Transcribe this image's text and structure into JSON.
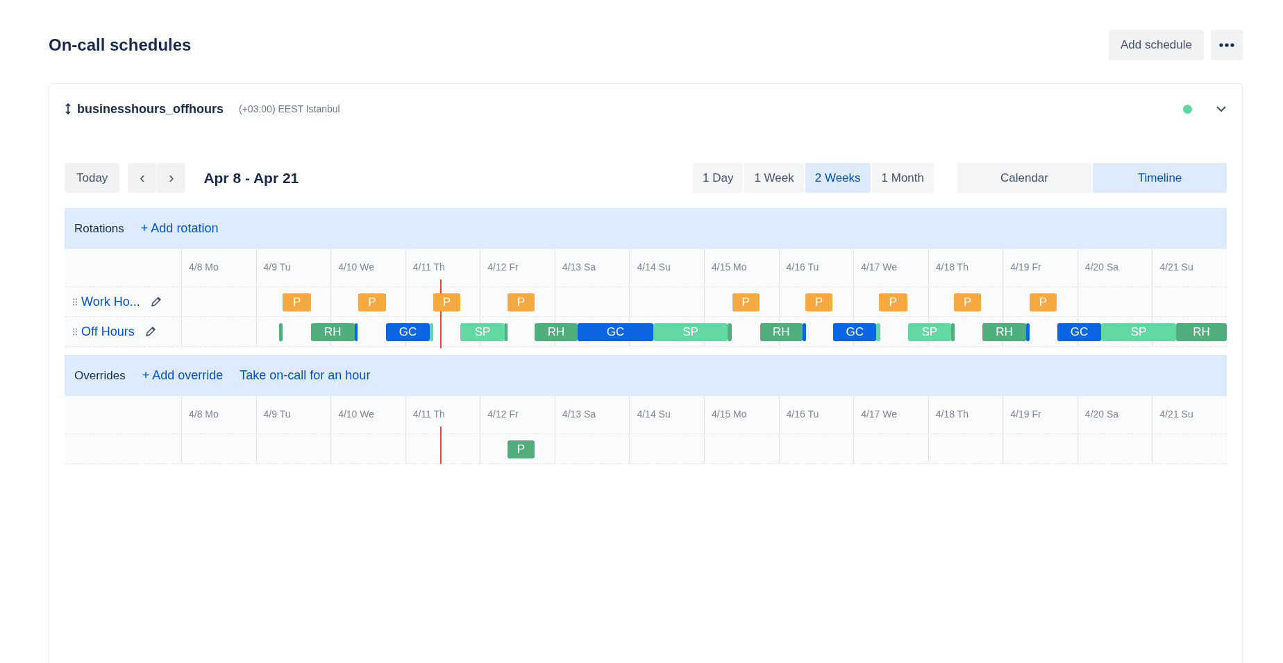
{
  "page": {
    "title": "On-call schedules",
    "buttons": [
      "Add schedule"
    ]
  },
  "schedule": {
    "name": "businesshours_offhours",
    "timezone": "(+03:00) EEST Istanbul",
    "expanded": true
  },
  "toolbar": {
    "today": "Today",
    "prev": "‹",
    "next": "›",
    "range_label": "Apr 8 - Apr 21",
    "ranges": [
      {
        "label": "1 Day",
        "selected": false
      },
      {
        "label": "1 Week",
        "selected": false
      },
      {
        "label": "2 Weeks",
        "selected": true
      },
      {
        "label": "1 Month",
        "selected": false
      }
    ],
    "views": [
      {
        "label": "Calendar",
        "selected": false
      },
      {
        "label": "Timeline",
        "selected": true
      }
    ]
  },
  "rotations": {
    "title": "Rotations",
    "actions": [
      "+ Add rotation"
    ],
    "days": [
      "4/8 Mo",
      "4/9 Tu",
      "4/10 We",
      "4/11 Th",
      "4/12 Fr",
      "4/13 Sa",
      "4/14 Su",
      "4/15 Mo",
      "4/16 Tu",
      "4/17 We",
      "4/18 Th",
      "4/19 Fr",
      "4/20 Sa",
      "4/21 Su"
    ],
    "rows": [
      {
        "name": "Work Ho...",
        "blocks": [
          {
            "label": "P",
            "color": "#f5a940"
          },
          {
            "label": "P",
            "color": "#f5a940"
          },
          {
            "label": "P",
            "color": "#f5a940"
          },
          {
            "label": "P",
            "color": "#f5a940"
          },
          {
            "label": "P",
            "color": "#f5a940"
          },
          {
            "label": "P",
            "color": "#f5a940"
          },
          {
            "label": "P",
            "color": "#f5a940"
          },
          {
            "label": "P",
            "color": "#f5a940"
          },
          {
            "label": "P",
            "color": "#f5a940"
          }
        ]
      },
      {
        "name": "Off Hours",
        "blocks": [
          {
            "color": "#4fae7c"
          },
          {
            "label": "RH",
            "color": "#4fae7c"
          },
          {
            "color": "#0c66e4"
          },
          {
            "label": "GC",
            "color": "#0c66e4"
          },
          {
            "color": "#62d9a2"
          },
          {
            "label": "SP",
            "color": "#62d9a2"
          },
          {
            "color": "#4fae7c"
          },
          {
            "label": "RH",
            "color": "#4fae7c"
          },
          {
            "label": "GC",
            "color": "#0c66e4"
          },
          {
            "label": "SP",
            "color": "#62d9a2"
          },
          {
            "color": "#4fae7c"
          },
          {
            "label": "RH",
            "color": "#4fae7c"
          },
          {
            "color": "#0c66e4"
          },
          {
            "label": "GC",
            "color": "#0c66e4"
          },
          {
            "color": "#62d9a2"
          },
          {
            "label": "SP",
            "color": "#62d9a2"
          },
          {
            "color": "#4fae7c"
          },
          {
            "label": "RH",
            "color": "#4fae7c"
          },
          {
            "color": "#0c66e4"
          },
          {
            "label": "GC",
            "color": "#0c66e4"
          },
          {
            "label": "SP",
            "color": "#62d9a2"
          },
          {
            "label": "RH",
            "color": "#4fae7c"
          }
        ]
      }
    ]
  },
  "overrides": {
    "title": "Overrides",
    "actions": [
      "+ Add override",
      "Take on-call for an hour"
    ],
    "days": [
      "4/8 Mo",
      "4/9 Tu",
      "4/10 We",
      "4/11 Th",
      "4/12 Fr",
      "4/13 Sa",
      "4/14 Su",
      "4/15 Mo",
      "4/16 Tu",
      "4/17 We",
      "4/18 Th",
      "4/19 Fr",
      "4/20 Sa",
      "4/21 Su"
    ],
    "rows": [
      {
        "blocks": [
          {
            "label": "P",
            "color": "#4fae7c"
          }
        ]
      }
    ]
  }
}
